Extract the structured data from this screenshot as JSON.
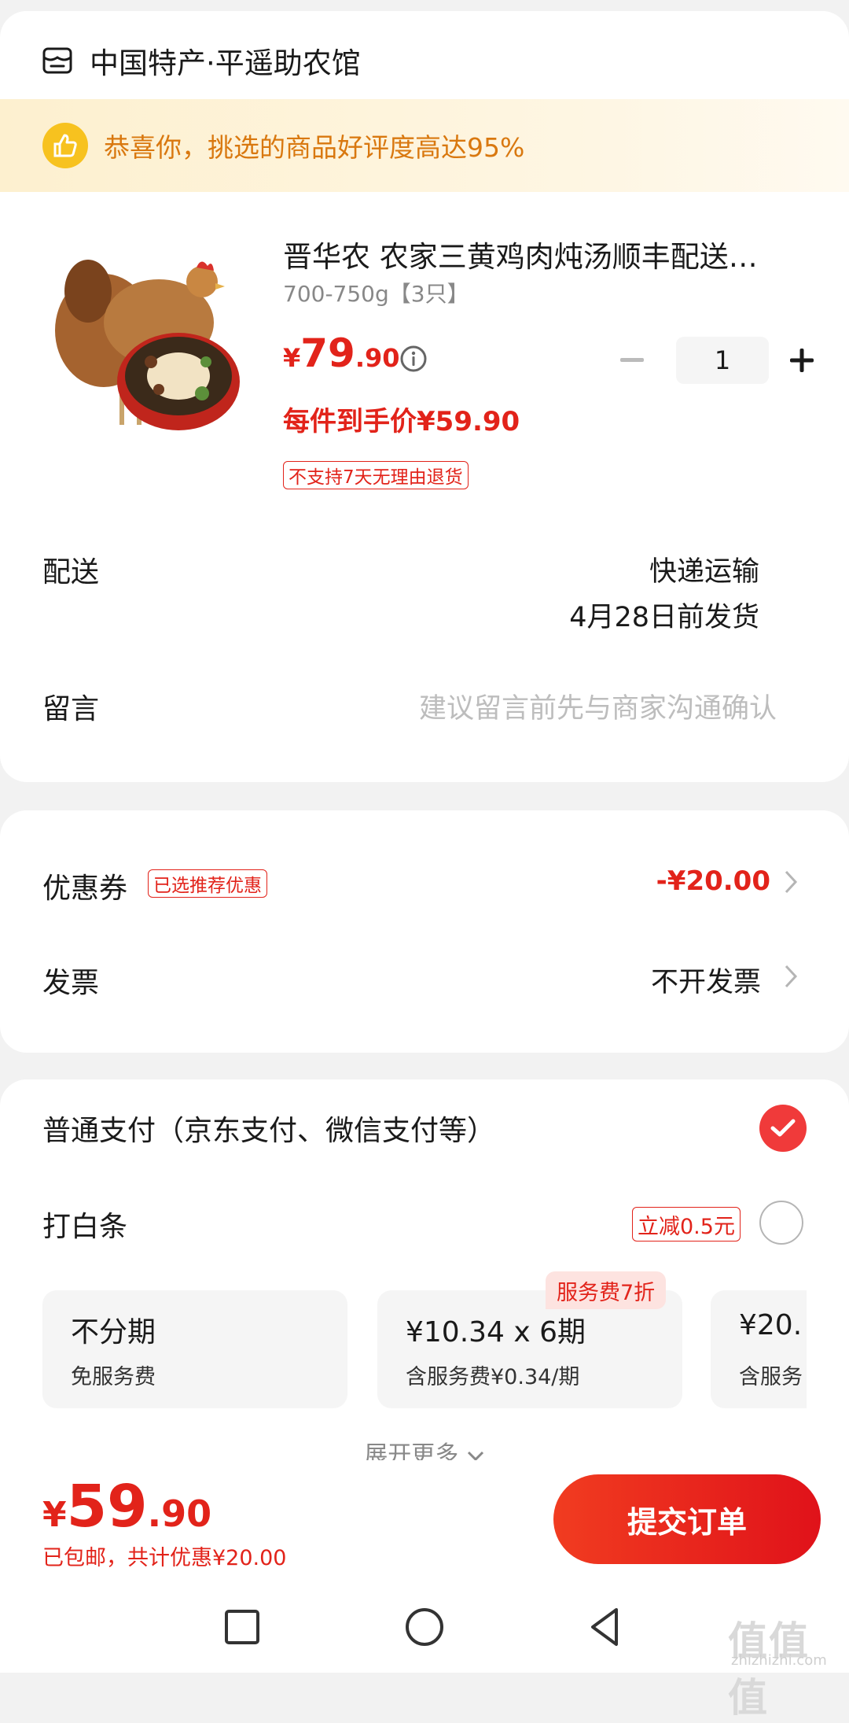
{
  "shop": {
    "name": "中国特产·平遥助农馆",
    "icon": "store-icon"
  },
  "banner": {
    "text": "恭喜你，挑选的商品好评度高达95%",
    "icon": "thumbs-up-icon"
  },
  "product": {
    "title": "晋华农 农家三黄鸡肉炖汤顺丰配送…",
    "spec": "700-750g【3只】",
    "price_yen": "¥",
    "price_int": "79",
    "price_dec": ".90",
    "quantity": "1",
    "final_price": "每件到手价¥59.90",
    "return_tag": "不支持7天无理由退货"
  },
  "delivery": {
    "label": "配送",
    "method": "快递运输",
    "date": "4月28日前发货"
  },
  "note": {
    "label": "留言",
    "placeholder": "建议留言前先与商家沟通确认"
  },
  "coupon": {
    "label": "优惠券",
    "tag": "已选推荐优惠",
    "value": "-¥20.00"
  },
  "invoice": {
    "label": "发票",
    "value": "不开发票"
  },
  "payment": {
    "normal_label": "普通支付（京东支付、微信支付等）",
    "baitiao_label": "打白条",
    "baitiao_tag": "立减0.5元",
    "installments": [
      {
        "main": "不分期",
        "sub": "免服务费"
      },
      {
        "main": "¥10.34 x 6期",
        "sub": "含服务费¥0.34/期"
      },
      {
        "main": "¥20.",
        "sub": "含服务"
      }
    ],
    "installment_badge": "服务费7折",
    "expand_label": "展开更多"
  },
  "footer": {
    "total_yen": "¥",
    "total_int": "59",
    "total_dec": ".90",
    "note": "已包邮，共计优惠¥20.00",
    "submit_label": "提交订单"
  },
  "watermark": {
    "main": "值值值",
    "sub": "zhizhizhi.com"
  },
  "colors": {
    "accent": "#e2231a",
    "banner_text": "#d9780f",
    "thumb": "#f7c21f"
  }
}
